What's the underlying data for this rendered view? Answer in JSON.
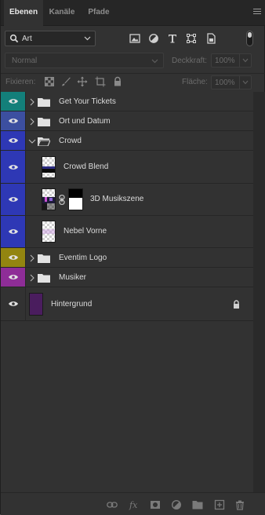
{
  "tabs": [
    {
      "label": "Ebenen",
      "active": true
    },
    {
      "label": "Kanäle",
      "active": false
    },
    {
      "label": "Pfade",
      "active": false
    }
  ],
  "filter": {
    "type_value": "Art",
    "icons": [
      "image-filter-icon",
      "adjustment-filter-icon",
      "type-filter-icon",
      "shape-filter-icon",
      "smart-object-filter-icon"
    ]
  },
  "blend": {
    "mode": "Normal",
    "opacity_label": "Deckkraft:",
    "opacity_value": "100%"
  },
  "lock": {
    "label": "Fixieren:",
    "fill_label": "Fläche:",
    "fill_value": "100%"
  },
  "layers": [
    {
      "name": "Get Your Tickets",
      "kind": "group",
      "color": "#137f7a",
      "expanded": false
    },
    {
      "name": "Ort und Datum",
      "kind": "group",
      "color": "#3c4fa0",
      "expanded": false
    },
    {
      "name": "Crowd",
      "kind": "group",
      "color": "#2e38b5",
      "expanded": true
    },
    {
      "name": "Crowd Blend",
      "kind": "layer",
      "color": "#2e38b5"
    },
    {
      "name": "3D Musikszene",
      "kind": "smart-mask",
      "color": "#2e38b5"
    },
    {
      "name": "Nebel Vorne",
      "kind": "layer",
      "color": "#2e38b5"
    },
    {
      "name": "Eventim Logo",
      "kind": "group",
      "color": "#938510",
      "expanded": false
    },
    {
      "name": "Musiker",
      "kind": "group",
      "color": "#8e2d97",
      "expanded": false
    },
    {
      "name": "Hintergrund",
      "kind": "background",
      "color": "#323232",
      "thumb_color": "#4a1d5e"
    }
  ],
  "colors": {
    "panel_bg": "#323232",
    "teal": "#137f7a",
    "slate_blue": "#3c4fa0",
    "blue": "#2e38b5",
    "olive": "#938510",
    "magenta": "#8e2d97",
    "background_purple": "#4a1d5e"
  },
  "bottom_icons": [
    "link-layers-icon",
    "fx-icon",
    "add-mask-icon",
    "adjustment-layer-icon",
    "new-group-icon",
    "new-layer-icon",
    "trash-icon"
  ]
}
